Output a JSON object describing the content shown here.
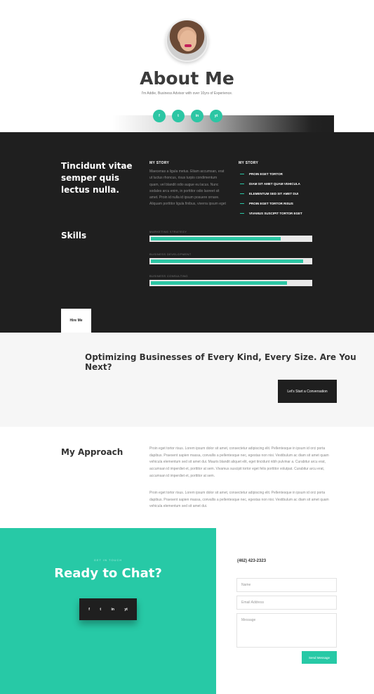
{
  "hero": {
    "title": "About Me",
    "subtitle": "I'm Addie, Business Advisor with over 10yrs of Experience.",
    "socials": [
      "f",
      "t",
      "in",
      "yt"
    ]
  },
  "about": {
    "headline": "Tincidunt vitae semper quis lectus nulla.",
    "story_title_1": "MY STORY",
    "story_text": "Maecenas a ligula metus. Etiam accumsan, erat ut luctus rhoncus, risus turpis condimentum quam, vel blandit odio augue eu lacus. Nunc sodales arcu enim, in porttitor odio laoreet sit amet. Proin id nulla id ipsum posuere ornare. Aliquam porttitor ligula finibus, viverra ipsum eget",
    "story_title_2": "MY STORY",
    "list": [
      "PROIN EGET TORTOR",
      "DIAM SIT AMET QUAM VEHICULA",
      "ELEMENTUM SED SIT AMET DUI",
      "PROIN EGET TORTOR RISUS",
      "VIVAMUS SUSCIPIT TORTOR EGET"
    ],
    "skills_title": "Skills",
    "skills": [
      {
        "label": "MARKETING STRATEGY",
        "percent": 81
      },
      {
        "label": "BUSINESS DEVELOPMENT",
        "percent": 95
      },
      {
        "label": "BUSINESS CONSULTING",
        "percent": 85
      }
    ],
    "hire_label": "Hire Me"
  },
  "cta": {
    "headline": "Optimizing Businesses of Every Kind, Every Size. Are You Next?",
    "button": "Let's Start a Conversation"
  },
  "approach": {
    "title": "My Approach",
    "p1": "Proin eget tortor risus. Lorem ipsum dolor sit amet, consectetur adipiscing elit. Pellentesque in ipsum id orci porta dapibus. Praesent sapien massa, convallis a pellentesque nec, egestas non nisi. Vestibulum ac diam sit amet quam vehicula elementum sed sit amet dui. Mauris blandit aliquet elit, eget tincidunt nibh pulvinar a. Curabitur arcu erat, accumsan id imperdiet et, porttitor at sem. Vivamus suscipit tortor eget felis porttitor volutpat. Curabitur arcu erat, accumsan id imperdiet et, porttitor at sem.",
    "p2": "Proin eget tortor risus. Lorem ipsum dolor sit amet, consectetur adipiscing elit. Pellentesque in ipsum id orci porta dapibus. Praesent sapien massa, convallis a pellentesque nec, egestas non nisi. Vestibulum ac diam sit amet quam vehicula elementum sed sit amet dui."
  },
  "contact": {
    "kicker": "GET IN TOUCH",
    "headline": "Ready to Chat?",
    "icons": [
      "f",
      "t",
      "in",
      "yt"
    ],
    "phone": "(462) 423-2323",
    "name_placeholder": "Name",
    "email_placeholder": "Email Address",
    "message_placeholder": "Message",
    "send": "Send Message"
  },
  "colors": {
    "accent": "#27c9a6",
    "dark": "#1f1f1f"
  }
}
